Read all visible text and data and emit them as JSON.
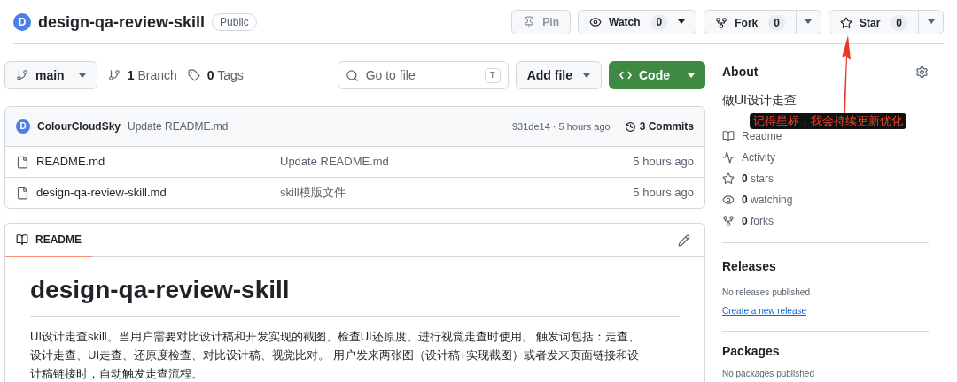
{
  "repo": {
    "avatar_letter": "D",
    "name": "design-qa-review-skill",
    "visibility": "Public"
  },
  "actions": [
    {
      "kind": "pin",
      "label": "Pin",
      "disabled": true
    },
    {
      "kind": "watch",
      "label": "Watch",
      "count": "0",
      "disabled": false
    },
    {
      "kind": "fork",
      "label": "Fork",
      "count": "0",
      "disabled": false
    },
    {
      "kind": "star",
      "label": "Star",
      "count": "0",
      "disabled": false
    }
  ],
  "toolbar": {
    "branch": "main",
    "branch_count": "1",
    "branch_label": "Branch",
    "tag_count": "0",
    "tag_label": "Tags",
    "search_placeholder": "Go to file",
    "search_shortcut": "T",
    "add_file": "Add file",
    "code": "Code"
  },
  "commit": {
    "avatar_letter": "D",
    "author": "ColourCloudSky",
    "message": "Update README.md",
    "meta": "931de14 · 5 hours ago",
    "commits_count": "3",
    "commits_label": "Commits"
  },
  "files": [
    {
      "name": "README.md",
      "message": "Update README.md",
      "time": "5 hours ago"
    },
    {
      "name": "design-qa-review-skill.md",
      "message": "skill模版文件",
      "time": "5 hours ago"
    }
  ],
  "readme": {
    "tab": "README",
    "heading": "design-qa-review-skill",
    "paragraph": "UI设计走查skill。当用户需要对比设计稿和开发实现的截图、检查UI还原度、进行视觉走查时使用。 触发词包括：走查、设计走查、UI走查、还原度检查、对比设计稿、视觉比对。 用户发来两张图（设计稿+实现截图）或者发来页面链接和设计稿链接时，自动触发走查流程。"
  },
  "about": {
    "title": "About",
    "description": "做UI设计走查",
    "links": [
      {
        "kind": "readme",
        "label": "Readme"
      },
      {
        "kind": "activity",
        "label": "Activity"
      },
      {
        "kind": "stars",
        "count": "0",
        "label": "stars"
      },
      {
        "kind": "watching",
        "count": "0",
        "label": "watching"
      },
      {
        "kind": "forks",
        "count": "0",
        "label": "forks"
      }
    ]
  },
  "releases": {
    "title": "Releases",
    "empty": "No releases published",
    "link": "Create a new release"
  },
  "packages": {
    "title": "Packages",
    "empty": "No packages published"
  },
  "annotation": {
    "text": "记得星标，我会持续更新优化"
  }
}
